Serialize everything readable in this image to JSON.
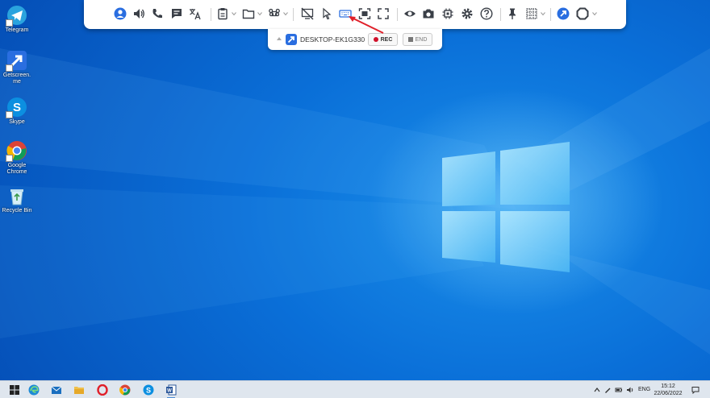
{
  "desktop": {
    "icons": [
      {
        "label": "Telegram",
        "icon": "telegram-icon"
      },
      {
        "label": "Getscreen.me",
        "icon": "getscreen-icon"
      },
      {
        "label": "Skype",
        "icon": "skype-icon"
      },
      {
        "label": "Google Chrome",
        "icon": "chrome-icon"
      },
      {
        "label": "Recycle Bin",
        "icon": "recycle-bin-icon"
      }
    ]
  },
  "toolbar": {
    "tools": [
      "user-icon",
      "sound-icon",
      "phone-icon",
      "chat-icon",
      "translate-icon",
      "clipboard-icon",
      "folder-icon",
      "command-icon",
      "monitor-off-icon",
      "cursor-icon",
      "keyboard-icon",
      "fit-screen-icon",
      "fullscreen-icon",
      "eye-icon",
      "camera-icon",
      "chip-icon",
      "gear-icon",
      "help-icon",
      "pin-icon",
      "grid-icon",
      "getscreen-logo-icon",
      "octagon-icon"
    ]
  },
  "session": {
    "host": "DESKTOP-EK1G330",
    "rec_label": "REC",
    "end_label": "END"
  },
  "taskbar": {
    "lang": "ENG",
    "time": "15:12",
    "date": "22/06/2022"
  },
  "colors": {
    "accent": "#2a6ee0",
    "toolbar_icon": "#3a3f47",
    "rec": "#d0102a",
    "arrow": "#e0202a"
  }
}
